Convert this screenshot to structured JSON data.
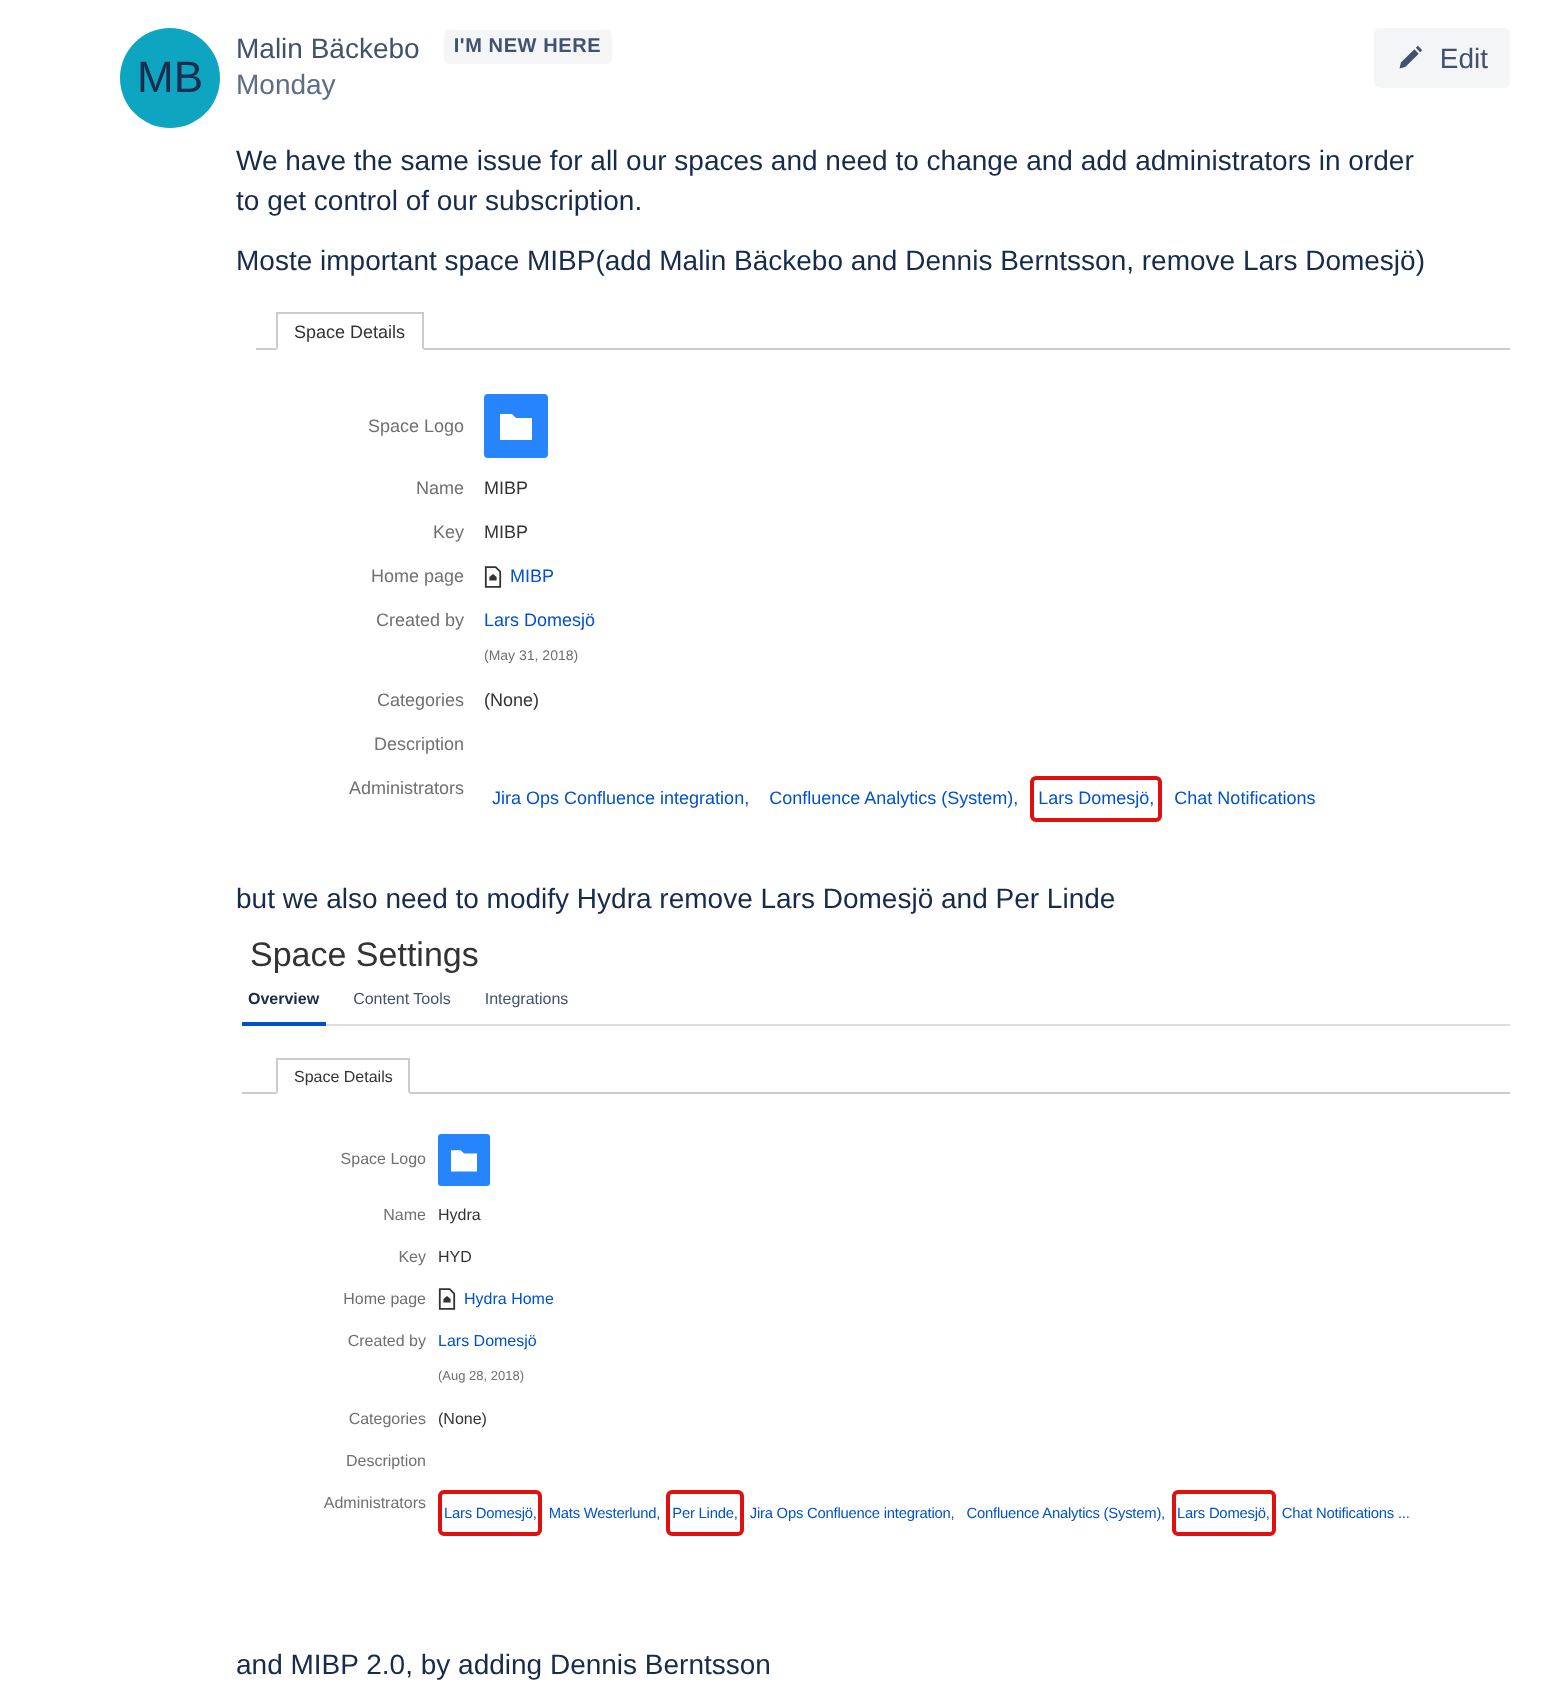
{
  "post": {
    "initials": "MB",
    "author": "Malin Bäckebo",
    "badge": "I'M NEW HERE",
    "date": "Monday",
    "edit_button": "Edit"
  },
  "blocks": [
    {
      "kind": "text",
      "text": "We have the same issue for all our spaces and need to change and add administrators in order to get control of our subscription."
    },
    {
      "kind": "text",
      "text": "Moste important space MIBP(add Malin Bäckebo and Dennis Berntsson, remove Lars Domesjö)"
    },
    {
      "kind": "screenshot",
      "detail_tab": "Space Details",
      "rows": [
        {
          "label": "Space Logo",
          "kind": "logo"
        },
        {
          "label": "Name",
          "kind": "text",
          "value": "MIBP"
        },
        {
          "label": "Key",
          "kind": "text",
          "value": "MIBP"
        },
        {
          "label": "Home page",
          "kind": "page_link",
          "value": "MIBP"
        },
        {
          "label": "Created by",
          "kind": "user_link",
          "value": "Lars Domesjö",
          "note": "(May 31, 2018)"
        },
        {
          "label": "Categories",
          "kind": "text",
          "value": "(None)"
        },
        {
          "label": "Description",
          "kind": "empty"
        },
        {
          "label": "Administrators",
          "kind": "admins",
          "items": [
            {
              "text": "Jira Ops Confluence integration,",
              "highlighted": false
            },
            {
              "text": "Confluence Analytics (System),",
              "highlighted": false
            },
            {
              "text": "Lars Domesjö,",
              "highlighted": true
            },
            {
              "text": "Chat Notifications",
              "highlighted": false
            }
          ]
        }
      ]
    },
    {
      "kind": "text",
      "text": "but we also need to modify Hydra remove Lars Domesjö and Per Linde"
    },
    {
      "kind": "screenshot",
      "title": "Space Settings",
      "nav_tabs": [
        {
          "label": "Overview",
          "selected": true
        },
        {
          "label": "Content Tools",
          "selected": false
        },
        {
          "label": "Integrations",
          "selected": false
        }
      ],
      "detail_tab": "Space Details",
      "rows": [
        {
          "label": "Space Logo",
          "kind": "logo"
        },
        {
          "label": "Name",
          "kind": "text",
          "value": "Hydra"
        },
        {
          "label": "Key",
          "kind": "text",
          "value": "HYD"
        },
        {
          "label": "Home page",
          "kind": "page_link",
          "value": "Hydra Home"
        },
        {
          "label": "Created by",
          "kind": "user_link",
          "value": "Lars Domesjö",
          "note": "(Aug 28, 2018)"
        },
        {
          "label": "Categories",
          "kind": "text",
          "value": "(None)"
        },
        {
          "label": "Description",
          "kind": "empty"
        },
        {
          "label": "Administrators",
          "kind": "admins",
          "items": [
            {
              "text": "Lars Domesjö,",
              "highlighted": true
            },
            {
              "text": "Mats Westerlund,",
              "highlighted": false
            },
            {
              "text": "Per Linde,",
              "highlighted": true
            },
            {
              "text": "Jira Ops Confluence integration,",
              "highlighted": false
            },
            {
              "text": "Confluence Analytics (System),",
              "highlighted": false
            },
            {
              "text": "Lars Domesjö,",
              "highlighted": true
            },
            {
              "text": "Chat Notifications ...",
              "highlighted": false
            }
          ]
        }
      ]
    },
    {
      "kind": "text",
      "text": "and MIBP 2.0, by adding Dennis Berntsson"
    }
  ]
}
